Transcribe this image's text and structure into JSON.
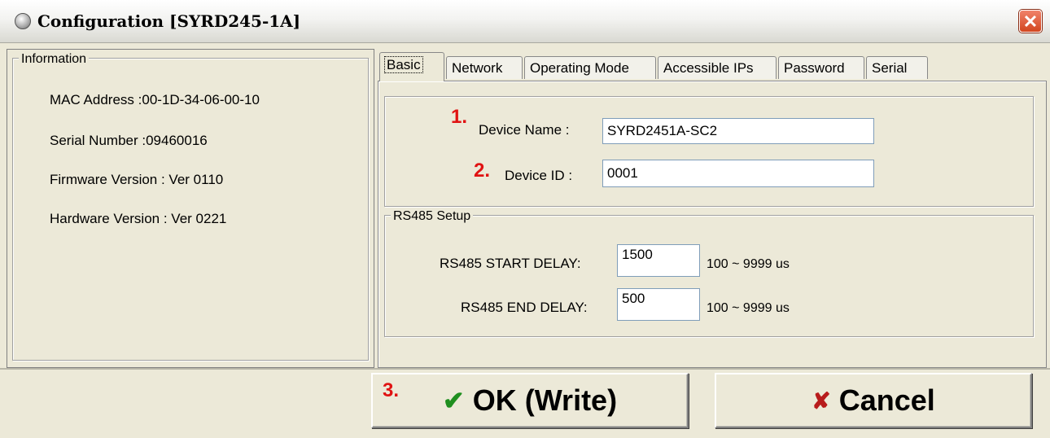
{
  "window": {
    "title": "Configuration [SYRD245-1A]",
    "close_glyph": "✕"
  },
  "information": {
    "legend": "Information",
    "mac_address": "MAC Address :00-1D-34-06-00-10",
    "serial_number": "Serial Number :09460016",
    "firmware_version": "Firmware Version : Ver 0110",
    "hardware_version": "Hardware Version : Ver 0221"
  },
  "tabs": [
    {
      "label": "Basic",
      "active": true
    },
    {
      "label": "Network",
      "active": false
    },
    {
      "label": "Operating Mode",
      "active": false
    },
    {
      "label": "Accessible IPs",
      "active": false
    },
    {
      "label": "Password",
      "active": false
    },
    {
      "label": "Serial",
      "active": false
    }
  ],
  "basic": {
    "device_name_step": "1.",
    "device_name_label": "Device Name :",
    "device_name_value": "SYRD2451A-SC2",
    "device_id_step": "2.",
    "device_id_label": "Device ID :",
    "device_id_value": "0001"
  },
  "rs485": {
    "legend": "RS485 Setup",
    "start_label": "RS485 START DELAY:",
    "start_value": "1500",
    "start_range": "100 ~ 9999 us",
    "end_label": "RS485 END DELAY:",
    "end_value": "500",
    "end_range": "100 ~ 9999 us"
  },
  "buttons": {
    "ok_step": "3.",
    "ok_label": "OK (Write)",
    "ok_icon": "check-icon",
    "cancel_label": "Cancel",
    "cancel_icon": "x-icon"
  },
  "colors": {
    "dialog_bg": "#ECE9D8",
    "step_number": "#e01212",
    "ok_check": "#1f8f1f",
    "cancel_x": "#b81c1c",
    "close_button": "#d2461f"
  }
}
